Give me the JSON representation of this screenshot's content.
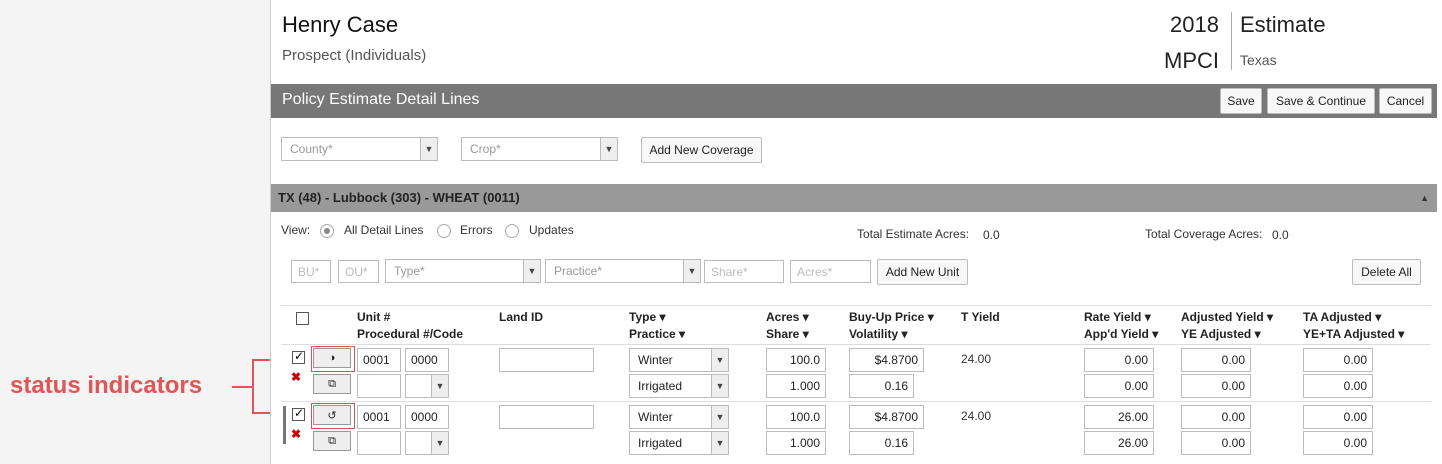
{
  "header": {
    "name": "Henry Case",
    "subtitle": "Prospect (Individuals)",
    "year": "2018",
    "program": "MPCI",
    "doc_type": "Estimate",
    "state": "Texas"
  },
  "toolbar": {
    "title": "Policy Estimate Detail Lines",
    "save": "Save",
    "save_continue": "Save & Continue",
    "cancel": "Cancel"
  },
  "filters": {
    "county_placeholder": "County*",
    "crop_placeholder": "Crop*",
    "add_coverage": "Add New Coverage"
  },
  "coverage": {
    "title": "TX (48) - Lubbock (303) - WHEAT (0011)",
    "view_label": "View:",
    "views": [
      "All Detail Lines",
      "Errors",
      "Updates"
    ],
    "selected_view": "All Detail Lines",
    "total_estimate_label": "Total Estimate Acres:",
    "total_estimate": "0.0",
    "total_coverage_label": "Total Coverage Acres:",
    "total_coverage": "0.0"
  },
  "new_unit": {
    "bu": "BU*",
    "ou": "OU*",
    "type": "Type*",
    "practice": "Practice*",
    "share": "Share*",
    "acres": "Acres*",
    "add_unit": "Add New Unit",
    "delete_all": "Delete All"
  },
  "columns": {
    "unit": "Unit #",
    "procedural": "Procedural #/Code",
    "land_id": "Land ID",
    "type": "Type",
    "practice": "Practice",
    "acres": "Acres",
    "share": "Share",
    "buyup": "Buy-Up Price",
    "volatility": "Volatility",
    "tyield": "T Yield",
    "rate_yield": "Rate Yield",
    "appd_yield": "App'd Yield",
    "adj_yield": "Adjusted Yield",
    "ye_adj": "YE Adjusted",
    "ta_adj": "TA Adjusted",
    "yeta_adj": "YE+TA Adjusted"
  },
  "rows": [
    {
      "unit": "0001",
      "procedural": "0000",
      "land_id": "",
      "type": "Winter",
      "practice": "Irrigated",
      "acres": "100.0",
      "share": "1.000",
      "buyup": "$4.8700",
      "volatility": "0.16",
      "tyield": "24.00",
      "rate_yield": "0.00",
      "appd_yield": "0.00",
      "adj_yield": "0.00",
      "ye_adj": "0.00",
      "ta_adj": "0.00",
      "yeta_adj": "0.00"
    },
    {
      "unit": "0001",
      "procedural": "0000",
      "land_id": "",
      "type": "Winter",
      "practice": "Irrigated",
      "acres": "100.0",
      "share": "1.000",
      "buyup": "$4.8700",
      "volatility": "0.16",
      "tyield": "24.00",
      "rate_yield": "26.00",
      "appd_yield": "26.00",
      "adj_yield": "0.00",
      "ye_adj": "0.00",
      "ta_adj": "0.00",
      "yeta_adj": "0.00"
    }
  ],
  "annotation": {
    "label": "status indicators"
  }
}
